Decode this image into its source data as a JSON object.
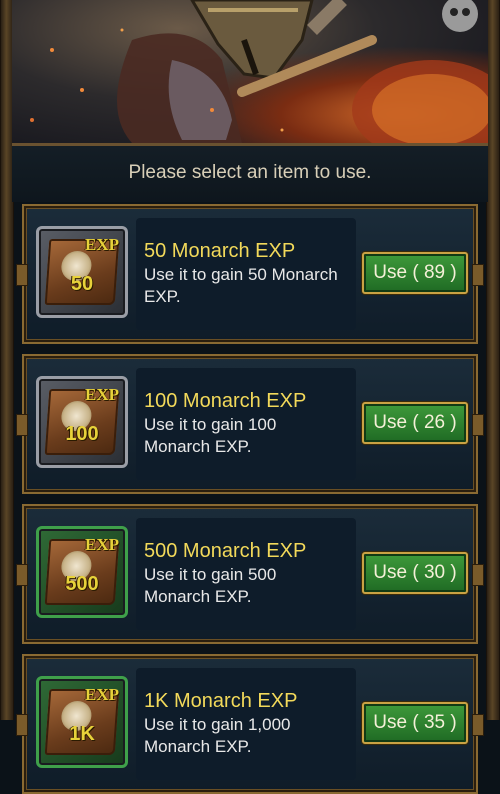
{
  "prompt": "Please select an item to use.",
  "items": [
    {
      "title": "50 Monarch EXP",
      "desc": "Use it to gain 50 Monarch EXP.",
      "icon_exp": "EXP",
      "icon_amount": "50",
      "button": "Use ( 89 )",
      "frame": "silver"
    },
    {
      "title": "100 Monarch EXP",
      "desc": "Use it to gain 100 Monarch EXP.",
      "icon_exp": "EXP",
      "icon_amount": "100",
      "button": "Use ( 26 )",
      "frame": "silver"
    },
    {
      "title": "500 Monarch EXP",
      "desc": "Use it to gain 500 Monarch EXP.",
      "icon_exp": "EXP",
      "icon_amount": "500",
      "button": "Use ( 30 )",
      "frame": "green"
    },
    {
      "title": "1K Monarch EXP",
      "desc": "Use it to gain 1,000 Monarch EXP.",
      "icon_exp": "EXP",
      "icon_amount": "1K",
      "button": "Use ( 35 )",
      "frame": "green"
    }
  ],
  "colors": {
    "title": "#f2d95a",
    "button": "#2f8a30",
    "frame": "#8a6a32"
  },
  "icons": {
    "banner": "warrior-artwork",
    "item": "exp-book-icon"
  }
}
